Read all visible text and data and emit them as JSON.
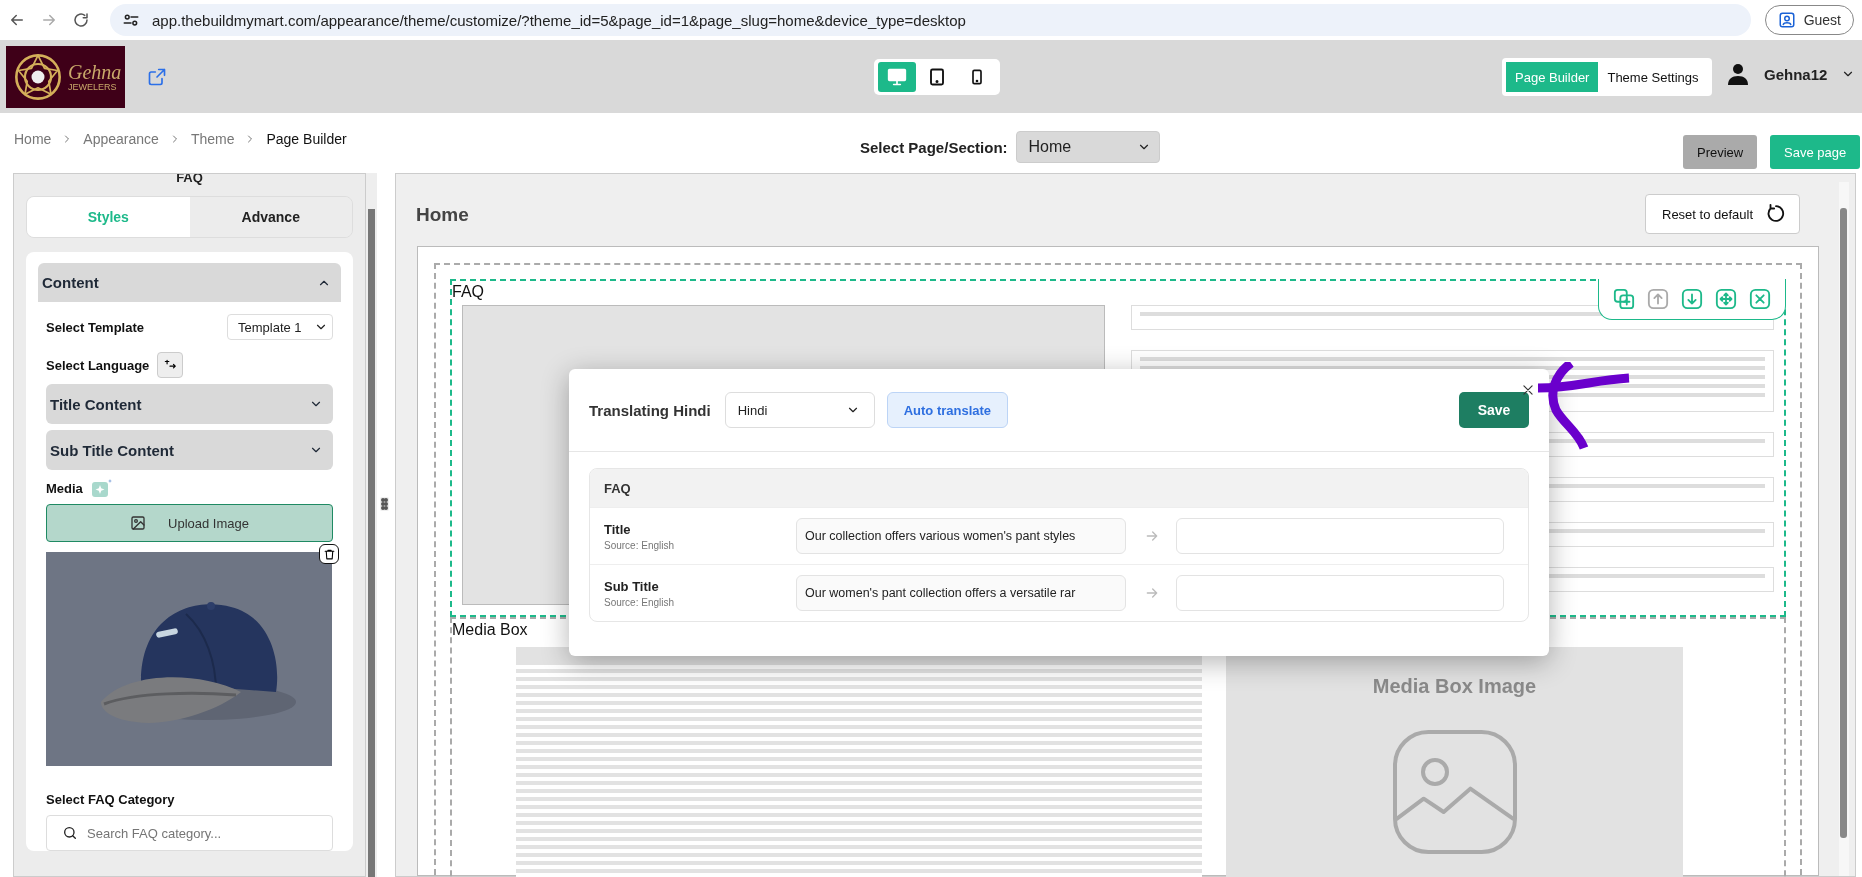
{
  "browser": {
    "url": "app.thebuildmymart.com/appearance/theme/customize/?theme_id=5&page_id=1&page_slug=home&device_type=desktop",
    "profile": "Guest"
  },
  "header": {
    "brand_name": "Gehna",
    "brand_tagline": "JEWELERS",
    "devices": [
      {
        "kind": "desktop",
        "selected": true
      },
      {
        "kind": "tablet",
        "selected": false
      },
      {
        "kind": "mobile",
        "selected": false
      }
    ],
    "modes": [
      {
        "label": "Page Builder",
        "selected": true
      },
      {
        "label": "Theme Settings",
        "selected": false
      }
    ],
    "user": "Gehna12"
  },
  "breadcrumb": [
    "Home",
    "Appearance",
    "Theme",
    "Page Builder"
  ],
  "page_select": {
    "label": "Select Page/Section:",
    "value": "Home"
  },
  "actions": [
    {
      "label": "Preview",
      "kind": "secondary"
    },
    {
      "label": "Save page",
      "kind": "primary"
    }
  ],
  "sidebar": {
    "section_title": "FAQ",
    "tabs": [
      {
        "label": "Styles",
        "selected": true
      },
      {
        "label": "Advance",
        "selected": false
      }
    ],
    "content": {
      "title": "Content",
      "expanded": true,
      "template_label": "Select Template",
      "template_value": "Template 1",
      "language_label": "Select Language",
      "groups": [
        {
          "title": "Title Content",
          "expanded": false
        },
        {
          "title": "Sub Title Content",
          "expanded": false
        }
      ],
      "media_label": "Media",
      "upload_label": "Upload Image",
      "category_label": "Select FAQ Category",
      "category_placeholder": "Search FAQ category..."
    }
  },
  "canvas": {
    "page_title": "Home",
    "reset_label": "Reset to default",
    "sections": [
      {
        "label": "FAQ",
        "kind": "faq",
        "selected": true
      },
      {
        "label": "Media Box",
        "kind": "media",
        "selected": false
      }
    ],
    "media_image_label": "Media Box Image"
  },
  "modal": {
    "title": "Translating Hindi",
    "language": "Hindi",
    "auto_translate": "Auto translate",
    "save": "Save",
    "group": "FAQ",
    "rows": [
      {
        "field": "Title",
        "source": "Source: English",
        "source_text": "Our collection offers various women's pant styles"
      },
      {
        "field": "Sub Title",
        "source": "Source: English",
        "source_text": "Our women's pant collection offers a versatile rar"
      }
    ]
  }
}
